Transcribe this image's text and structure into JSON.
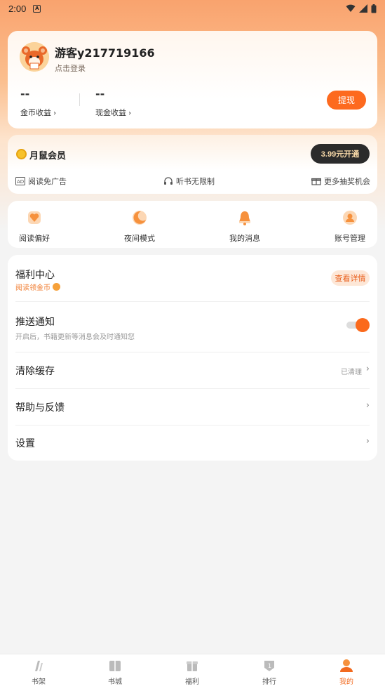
{
  "status_bar": {
    "time": "2:00",
    "notif_icon": "A"
  },
  "user": {
    "name": "游客y217719166",
    "login_hint": "点击登录",
    "coin_value": "--",
    "coin_label": "金币收益",
    "cash_value": "--",
    "cash_label": "现金收益",
    "withdraw_label": "提现"
  },
  "vip": {
    "title": "月鼠会员",
    "button_label": "3.99元开通",
    "perks": [
      {
        "label": "阅读免广告",
        "icon": "ad-icon"
      },
      {
        "label": "听书无限制",
        "icon": "headphones-icon"
      },
      {
        "label": "更多抽奖机会",
        "icon": "gift-icon"
      }
    ]
  },
  "quick_actions": [
    {
      "label": "阅读偏好",
      "icon": "heart-icon"
    },
    {
      "label": "夜间模式",
      "icon": "moon-icon"
    },
    {
      "label": "我的消息",
      "icon": "bell-icon"
    },
    {
      "label": "账号管理",
      "icon": "user-icon"
    }
  ],
  "settings": {
    "welfare": {
      "title": "福利中心",
      "subtitle": "阅读领金币",
      "button": "查看详情"
    },
    "push": {
      "title": "推送通知",
      "subtitle": "开启后，书籍更新等消息会及时通知您",
      "enabled": true
    },
    "cache": {
      "title": "清除缓存",
      "hint": "已清理"
    },
    "help": {
      "title": "帮助与反馈"
    },
    "settings": {
      "title": "设置"
    }
  },
  "tabs": [
    {
      "label": "书架",
      "icon": "bookshelf-icon",
      "active": false
    },
    {
      "label": "书城",
      "icon": "bookstore-icon",
      "active": false
    },
    {
      "label": "福利",
      "icon": "welfare-icon",
      "active": false
    },
    {
      "label": "排行",
      "icon": "ranking-icon",
      "active": false
    },
    {
      "label": "我的",
      "icon": "profile-icon",
      "active": true
    }
  ],
  "colors": {
    "accent": "#fd6a1f",
    "vip_dark": "#2b2b2b",
    "vip_gold": "#f8d9a8"
  }
}
